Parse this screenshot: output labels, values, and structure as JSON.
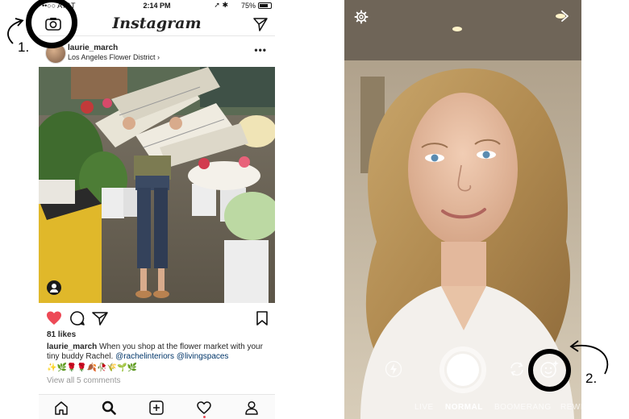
{
  "feed": {
    "status": {
      "carrier": "••○○ AT&T",
      "time": "2:14 PM",
      "battery": "75%"
    },
    "brand": "Instagram",
    "post": {
      "username": "laurie_march",
      "location": "Los Angeles Flower District",
      "likes": "81 likes",
      "caption_user": "laurie_march",
      "caption_text": " When you shop at the flower market with your tiny buddy Rachel. ",
      "mention_1": "@rachelinteriors",
      "mention_2": "@livingspaces",
      "emoji_line": "✨🌿🌹🌹🍂🥀🌾🌱🌿",
      "comments_link": "View all 5 comments",
      "liked": true
    },
    "icons": {
      "camera": "camera-icon",
      "direct": "direct-message-icon",
      "heart": "heart-icon",
      "comment": "comment-icon",
      "share": "share-icon",
      "bookmark": "bookmark-icon",
      "home": "home-icon",
      "search": "search-icon",
      "add": "add-post-icon",
      "activity": "activity-icon",
      "profile": "profile-icon"
    },
    "colors": {
      "like_red": "#ed4956",
      "mention_blue": "#003569",
      "notification_dot": "#ed4956"
    }
  },
  "camera": {
    "modes": [
      "LIVE",
      "NORMAL",
      "BOOMERANG",
      "REWI"
    ],
    "active_mode": "NORMAL",
    "icons": {
      "settings": "settings-gear-icon",
      "forward": "chevron-right-icon",
      "flash": "flash-icon",
      "flip": "flip-camera-icon",
      "face_filter": "face-filter-icon"
    }
  },
  "annotations": {
    "step_1": "1.",
    "step_2": "2."
  }
}
